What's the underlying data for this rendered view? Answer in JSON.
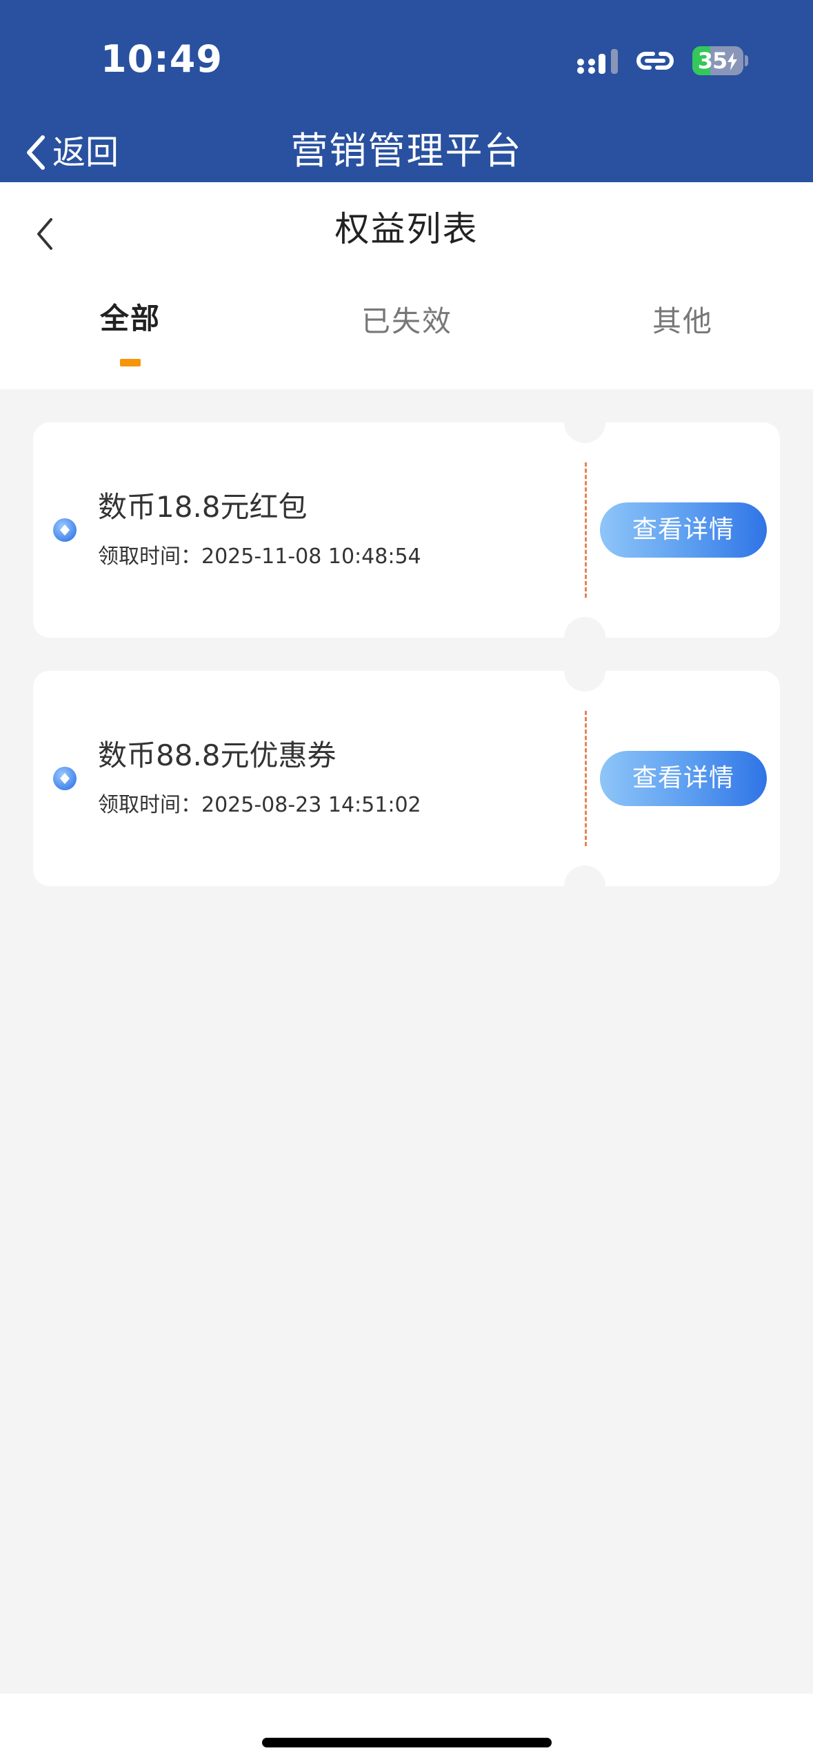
{
  "status_bar": {
    "time": "10:49",
    "battery_level": 35,
    "battery_text": "35",
    "icons": [
      "signal-icon",
      "link-icon",
      "battery-icon",
      "bolt-icon"
    ]
  },
  "nav": {
    "back_label": "返回",
    "title": "营销管理平台"
  },
  "page": {
    "title": "权益列表",
    "tabs": [
      {
        "label": "全部",
        "active": true
      },
      {
        "label": "已失效",
        "active": false
      },
      {
        "label": "其他",
        "active": false
      }
    ]
  },
  "rewards": [
    {
      "title": "数币18.8元红包",
      "time_label": "领取时间：",
      "time": "2025-11-08 10:48:54",
      "button_label": "查看详情"
    },
    {
      "title": "数币88.8元优惠券",
      "time_label": "领取时间：",
      "time": "2025-08-23 14:51:02",
      "button_label": "查看详情"
    }
  ],
  "colors": {
    "nav_background": "#2951a0",
    "tab_indicator": "#f5960a",
    "divider": "#e98053",
    "button_start": "#8ec5f8",
    "button_end": "#2f74e6",
    "battery_fill": "#34c759"
  }
}
